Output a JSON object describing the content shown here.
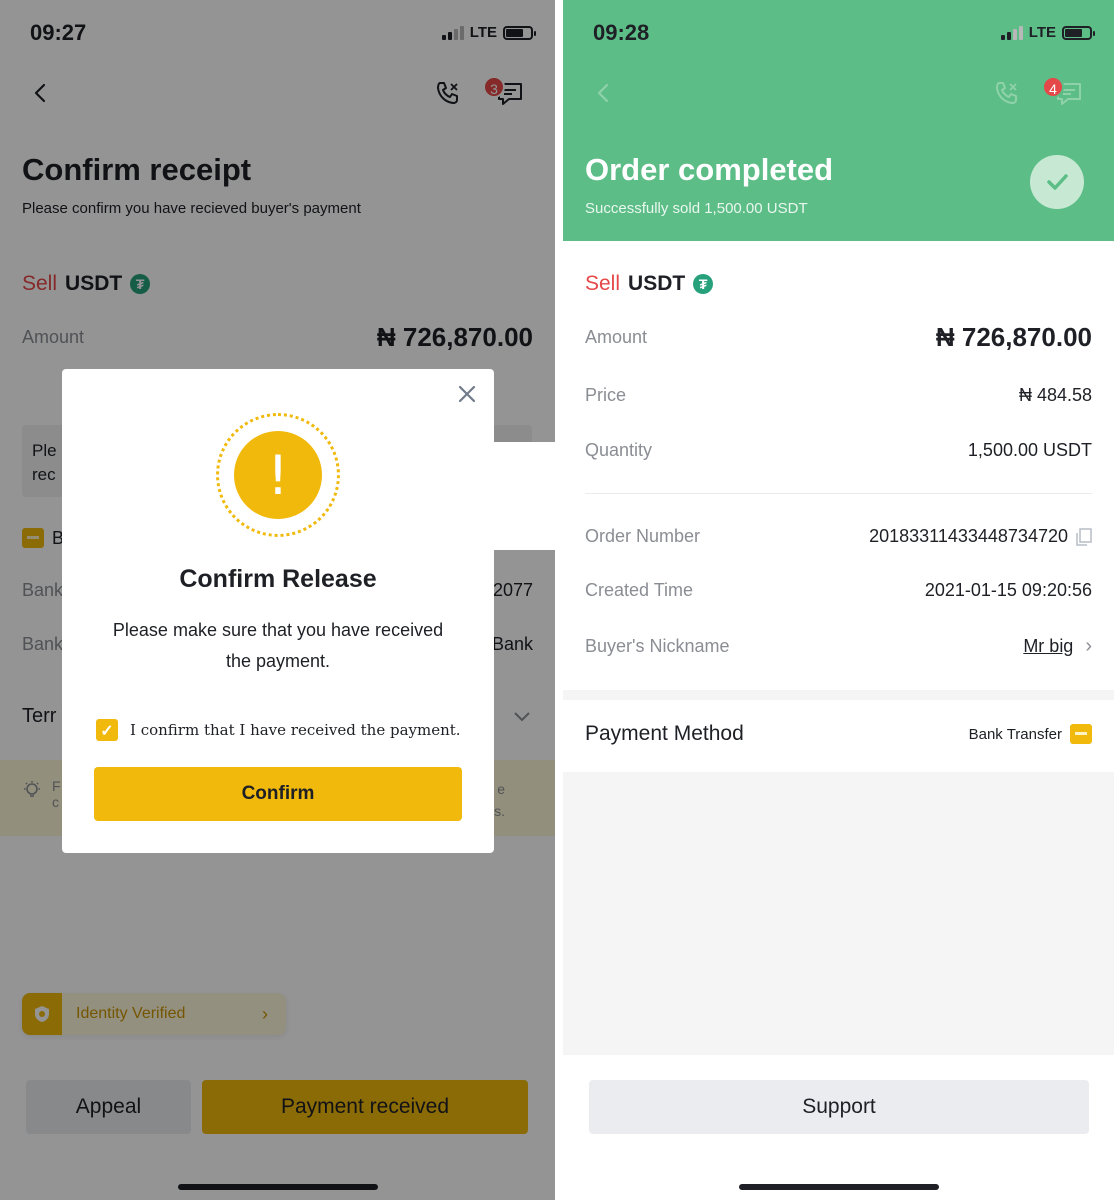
{
  "left": {
    "status": {
      "time": "09:27",
      "network": "LTE"
    },
    "chat_badge": "3",
    "title": "Confirm receipt",
    "subtitle": "Please confirm you have recieved buyer's payment",
    "sell_label": "Sell",
    "asset": "USDT",
    "amount_label": "Amount",
    "amount_value": "₦ 726,870.00",
    "notice_fragment_1": "Ple",
    "notice_fragment_2": "rec",
    "bank_label_fragment": "B",
    "bank_row_1": {
      "label": "Bank",
      "value": "2077"
    },
    "bank_row_2": {
      "label": "Bank",
      "value": "Bank"
    },
    "terms_fragment": "Terr",
    "tip_left": "F",
    "tip_left2": "c",
    "tip_right": "e",
    "tip_right2": "s.",
    "identity": "Identity Verified",
    "appeal_button": "Appeal",
    "payment_received_button": "Payment received",
    "modal": {
      "title": "Confirm Release",
      "body": "Please make sure that you have received the payment.",
      "checkbox_label": "I confirm that I have received the payment.",
      "checked": true,
      "confirm_button": "Confirm"
    }
  },
  "right": {
    "status": {
      "time": "09:28",
      "network": "LTE"
    },
    "chat_badge": "4",
    "title": "Order completed",
    "subtitle": "Successfully sold 1,500.00 USDT",
    "sell_label": "Sell",
    "asset": "USDT",
    "rows": [
      {
        "label": "Amount",
        "value": "₦ 726,870.00"
      },
      {
        "label": "Price",
        "value": "₦ 484.58"
      },
      {
        "label": "Quantity",
        "value": "1,500.00 USDT"
      },
      {
        "label": "Order Number",
        "value": "20183311433448734720"
      },
      {
        "label": "Created Time",
        "value": "2021-01-15 09:20:56"
      },
      {
        "label": "Buyer's Nickname",
        "value": "Mr big"
      }
    ],
    "payment_method_label": "Payment Method",
    "payment_method_value": "Bank Transfer",
    "support_button": "Support"
  },
  "colors": {
    "accent": "#f0b90b",
    "success": "#5cbd87",
    "sell": "#e54848",
    "tether": "#26a17b"
  },
  "icons": [
    "back-icon",
    "phone-icon",
    "chat-icon",
    "tether-icon",
    "close-icon",
    "exclamation-icon",
    "checkmark-icon",
    "copy-icon",
    "bank-card-icon",
    "shield-icon",
    "bulb-icon",
    "chevron-down-icon",
    "chevron-right-icon"
  ]
}
